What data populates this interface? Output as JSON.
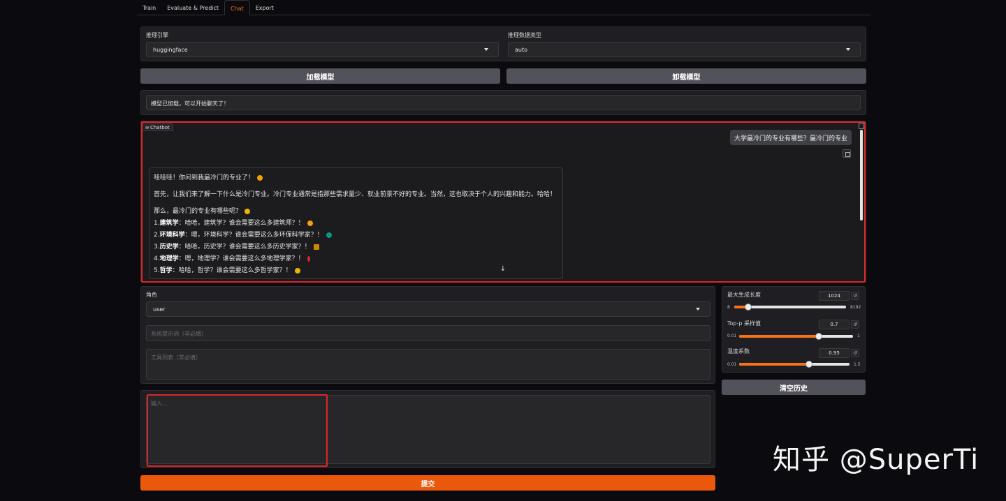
{
  "tabs": [
    "Train",
    "Evaluate & Predict",
    "Chat",
    "Export"
  ],
  "active_tab": "Chat",
  "infer_backend": {
    "label": "推理引擎",
    "value": "huggingface"
  },
  "infer_dtype": {
    "label": "推理数据类型",
    "value": "auto"
  },
  "buttons": {
    "load": "加载模型",
    "unload": "卸载模型",
    "clear": "清空历史",
    "submit": "提交"
  },
  "status": "模型已加载，可以开始聊天了！",
  "chatbot": {
    "label": "Chatbot",
    "user_message": "大学最冷门的专业有哪些？最冷门的专业",
    "bot_intro": "哇哇哇！你问到我最冷门的专业了！",
    "bot_para1": "首先，让我们来了解一下什么是冷门专业。冷门专业通常是指那些需求量少、就业前景不好的专业。当然，这也取决于个人的兴趣和能力。哈哈！",
    "bot_para2": "那么，最冷门的专业有哪些呢？",
    "items": [
      {
        "num": "1.",
        "name": "建筑学",
        "text": "：哈哈，建筑学？谁会需要这么多建筑师？！"
      },
      {
        "num": "2.",
        "name": "环境科学",
        "text": "：嗯，环境科学？谁会需要这么多环保科学家？！"
      },
      {
        "num": "3.",
        "name": "历史学",
        "text": "：哈哈，历史学？谁会需要这么多历史学家？！"
      },
      {
        "num": "4.",
        "name": "地理学",
        "text": "：嗯，地理学？谁会需要这么多地理学家？！"
      },
      {
        "num": "5.",
        "name": "哲学",
        "text": "：哈哈，哲学？谁会需要这么多哲学家？！"
      }
    ]
  },
  "role": {
    "label": "角色",
    "value": "user"
  },
  "system_prompt_placeholder": "系统提示词（非必填）",
  "tools_placeholder": "工具列表（非必填）",
  "input_placeholder": "输入...",
  "params": [
    {
      "label": "最大生成长度",
      "value": "1024",
      "min": "8",
      "max": "8192",
      "fraction": 0.124
    },
    {
      "label": "Top-p 采样值",
      "value": "0.7",
      "min": "0.01",
      "max": "1",
      "fraction": 0.697
    },
    {
      "label": "温度系数",
      "value": "0.95",
      "min": "0.01",
      "max": "1.5",
      "fraction": 0.631
    }
  ],
  "watermark": "知乎 @SuperTi",
  "colors": {
    "accent": "#f97316",
    "highlight_box": "#dc2626",
    "background": "#0b0b0f"
  }
}
